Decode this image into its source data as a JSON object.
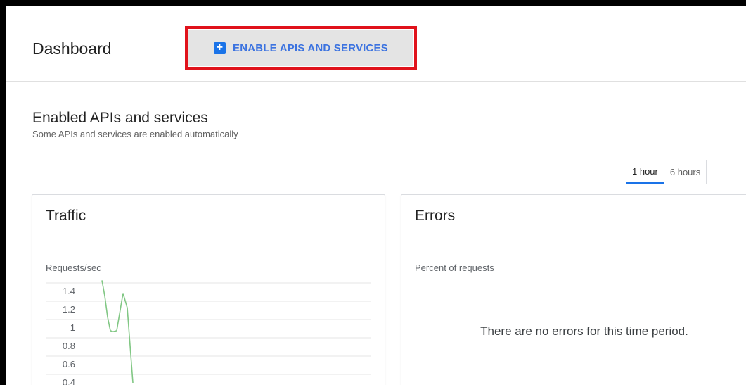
{
  "header": {
    "title": "Dashboard",
    "enable_button": {
      "label": "ENABLE APIS AND SERVICES",
      "icon": "plus-box-icon"
    },
    "highlight_color": "#e0121b"
  },
  "section": {
    "title": "Enabled APIs and services",
    "subtitle": "Some APIs and services are enabled automatically"
  },
  "time_range": {
    "tabs": [
      {
        "label": "1 hour",
        "active": true
      },
      {
        "label": "6 hours",
        "active": false
      }
    ]
  },
  "traffic_card": {
    "title": "Traffic",
    "metric_label": "Requests/sec"
  },
  "errors_card": {
    "title": "Errors",
    "metric_label": "Percent of requests",
    "empty_message": "There are no errors for this time period."
  },
  "chart_data": {
    "type": "line",
    "ylabel": "Requests/sec",
    "y_ticks": [
      "1.4",
      "1.2",
      "1",
      "0.8",
      "0.6",
      "0.4"
    ],
    "grid": true,
    "line_color": "#81c784",
    "series": [
      {
        "values": [
          1.52,
          1.35,
          1.12,
          0.97,
          0.96,
          0.97,
          1.38,
          1.22,
          0.4
        ]
      }
    ]
  }
}
